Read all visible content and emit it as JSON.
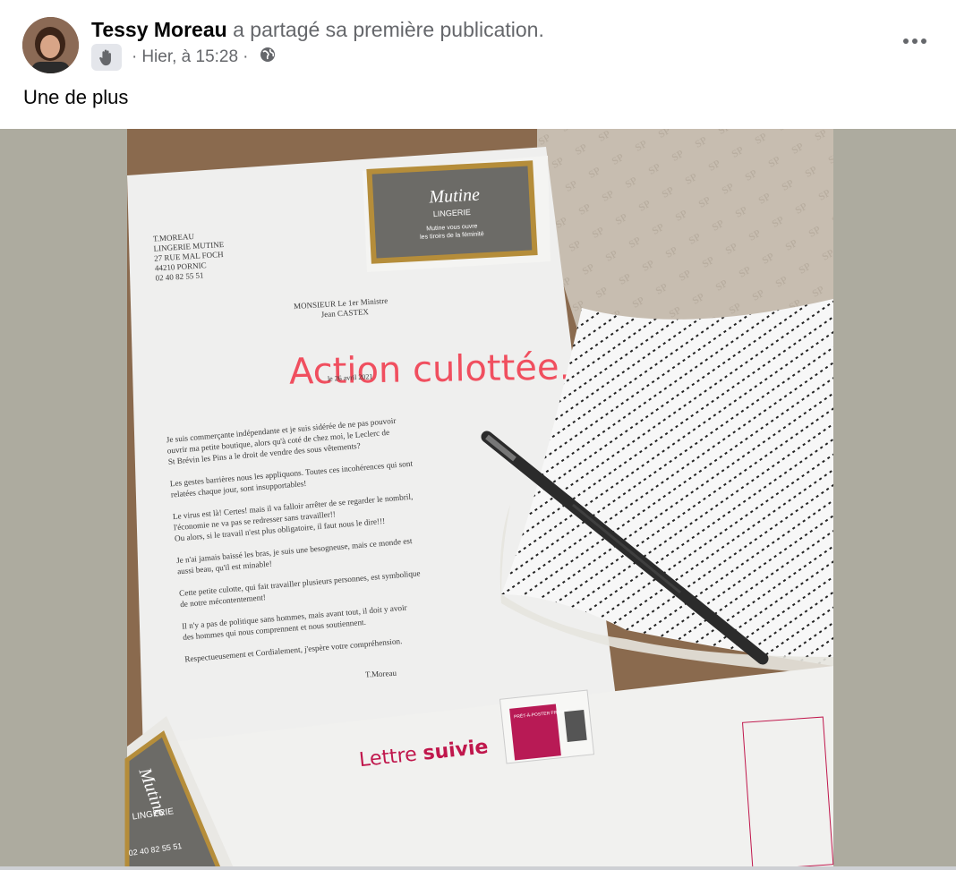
{
  "post": {
    "author": "Tessy Moreau",
    "action": "a partagé sa première publication.",
    "timestamp": "Hier, à 15:28",
    "separator": "·",
    "caption": "Une de plus",
    "badge_icon": "waving-hand-icon",
    "privacy_icon": "globe-icon",
    "more_icon": "more-options-icon"
  },
  "photo": {
    "card": {
      "brand": "Mutine",
      "subtitle": "LINGERIE",
      "tagline_1": "Mutine vous ouvre",
      "tagline_2": "les tiroirs de la féminité"
    },
    "sender": [
      "T.MOREAU",
      "LINGERIE MUTINE",
      "27 RUE MAL FOCH",
      "44210 PORNIC",
      "02 40 82 55 51"
    ],
    "recipient_1": "MONSIEUR Le 1er Ministre",
    "recipient_2": "Jean CASTEX",
    "overlay_title": "Action culottée....",
    "date": "le 26 avril 2021",
    "body_lines": [
      "Je suis commerçante indépendante et je suis sidérée de ne pas pouvoir",
      "ouvrir ma petite boutique, alors qu'à coté de chez moi, le Leclerc de",
      "St Brévin les Pins a le droit de vendre des sous vêtements?",
      "",
      "Les gestes barrières nous les appliquons. Toutes ces incohérences qui sont",
      "relatées chaque jour,  sont insupportables!",
      "",
      "Le virus est là! Certes! mais il va falloir arrêter de se regarder le nombril,",
      "l'économie ne va pas se redresser sans travailler!!",
      "Ou alors, si le travail n'est plus obligatoire, il faut nous le dire!!!",
      "",
      "Je n'ai jamais baissé les bras, je suis une besogneuse, mais ce monde est",
      "aussi beau, qu'il est minable!",
      "",
      "Cette petite culotte, qui fait travailler plusieurs personnes, est symbolique",
      "de notre mécontentement!",
      "",
      "Il n'y a pas de politique sans hommes, mais avant tout, il doit y avoir",
      "des hommes qui nous comprennent et nous soutiennent.",
      "",
      "Respectueusement et Cordialement, j'espère votre compréhension."
    ],
    "signature": "T.Moreau",
    "envelope_label_1": "Lettre ",
    "envelope_label_2": "suivie",
    "stamp_text": "PRÊT-À-POSTER FRANCE",
    "card2_brand": "Mutine",
    "card2_subtitle": "LINGERIE",
    "card2_phone": "02 40 82 55 51"
  }
}
